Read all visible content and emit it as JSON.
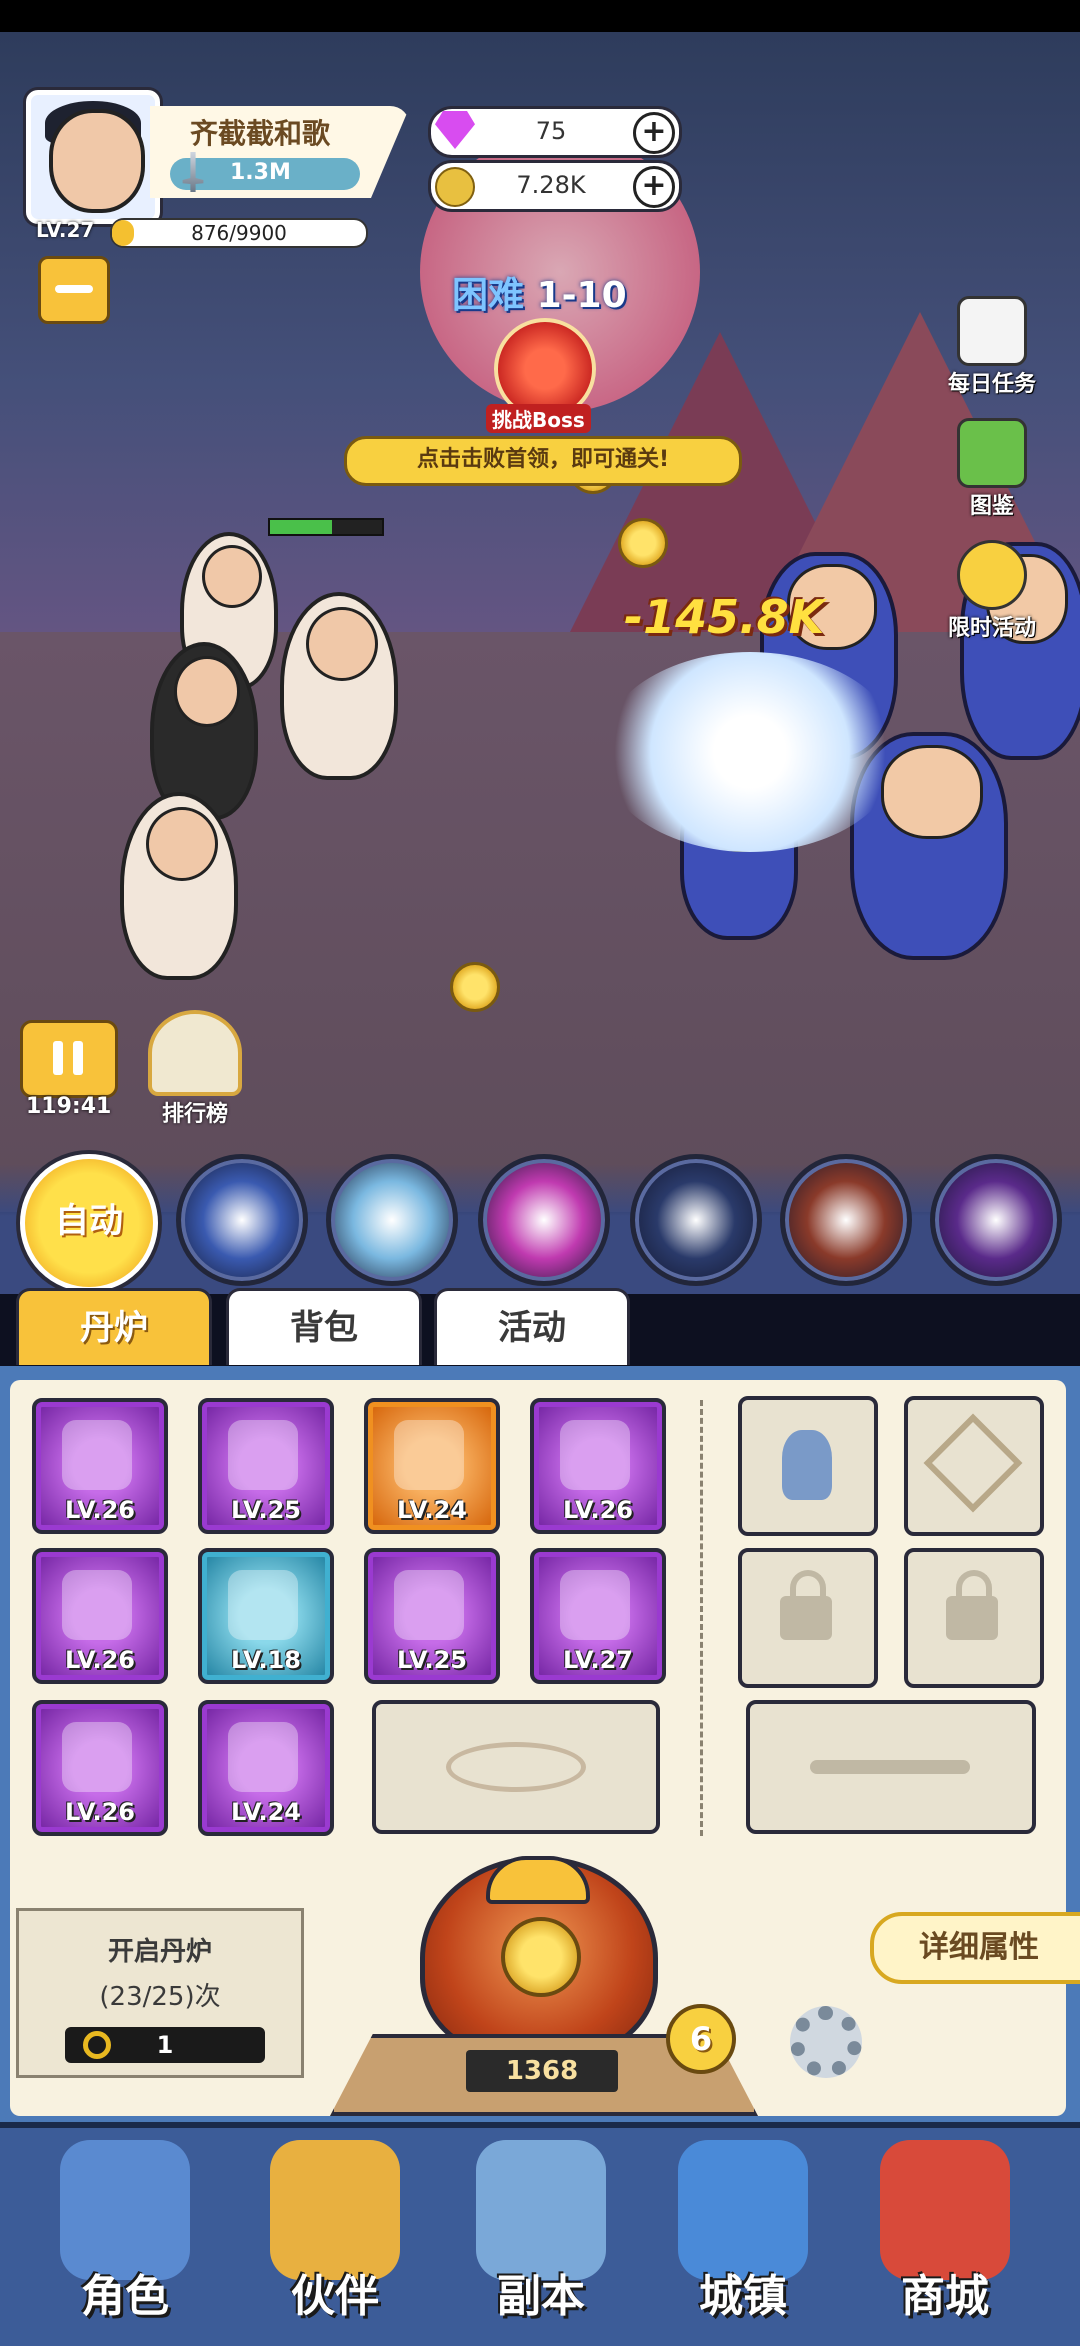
{
  "player": {
    "name": "齐截截和歌",
    "power": "1.3M",
    "level": "LV.27",
    "exp": "876/9900",
    "exp_fraction": 0.088
  },
  "resources": {
    "gems": "75",
    "gold": "7.28K"
  },
  "stage": {
    "difficulty": "困难",
    "number": "1-10",
    "boss_label": "挑战Boss",
    "hint": "点击击败首领，即可通关!"
  },
  "combat": {
    "damage": "-145.8K",
    "timer": "119:41"
  },
  "side_menu": [
    {
      "label": "每日任务",
      "icon": "task-icon"
    },
    {
      "label": "图鉴",
      "icon": "book-icon"
    },
    {
      "label": "限时活动",
      "icon": "event-icon"
    }
  ],
  "ranking_label": "排行榜",
  "auto_label": "自动",
  "skills": [
    {
      "icon": "meteor-icon",
      "color": "#3a5ab0"
    },
    {
      "icon": "unicorn-icon",
      "color": "#7ab8e0"
    },
    {
      "icon": "vortex-icon",
      "color": "#c03ab0"
    },
    {
      "icon": "lightning-icon",
      "color": "#2a3a6a"
    },
    {
      "icon": "beast-icon",
      "color": "#8a3a2a"
    },
    {
      "icon": "shuriken-icon",
      "color": "#5a2a8a"
    }
  ],
  "tabs": {
    "furnace": "丹炉",
    "bag": "背包",
    "activity": "活动"
  },
  "inventory": [
    {
      "level": "LV.26",
      "rarity": "purple",
      "icon": "dagger-icon"
    },
    {
      "level": "LV.25",
      "rarity": "purple",
      "icon": "boots-icon"
    },
    {
      "level": "LV.24",
      "rarity": "orange",
      "icon": "armor-icon"
    },
    {
      "level": "LV.26",
      "rarity": "purple",
      "icon": "dragon-orb-icon"
    },
    {
      "level": "LV.26",
      "rarity": "purple",
      "icon": "sword-icon"
    },
    {
      "level": "LV.18",
      "rarity": "blue",
      "icon": "jade-icon"
    },
    {
      "level": "LV.25",
      "rarity": "purple",
      "icon": "pendant-icon"
    },
    {
      "level": "LV.27",
      "rarity": "purple",
      "icon": "fire-orb-icon"
    },
    {
      "level": "LV.26",
      "rarity": "purple",
      "icon": "whip-icon"
    },
    {
      "level": "LV.24",
      "rarity": "purple",
      "icon": "shoes-icon"
    }
  ],
  "furnace": {
    "title": "开启丹炉",
    "count": "(23/25)次",
    "keys": "1",
    "coins": "1368",
    "badge": "6"
  },
  "detail_label": "详细属性",
  "nav": [
    {
      "label": "角色",
      "icon": "character-icon",
      "color": "#5a8ad0"
    },
    {
      "label": "伙伴",
      "icon": "partner-icon",
      "color": "#e8b040"
    },
    {
      "label": "副本",
      "icon": "scroll-icon",
      "color": "#7aa8d8"
    },
    {
      "label": "城镇",
      "icon": "town-icon",
      "color": "#4a8ad8"
    },
    {
      "label": "商城",
      "icon": "shop-icon",
      "color": "#d84a3a"
    }
  ]
}
